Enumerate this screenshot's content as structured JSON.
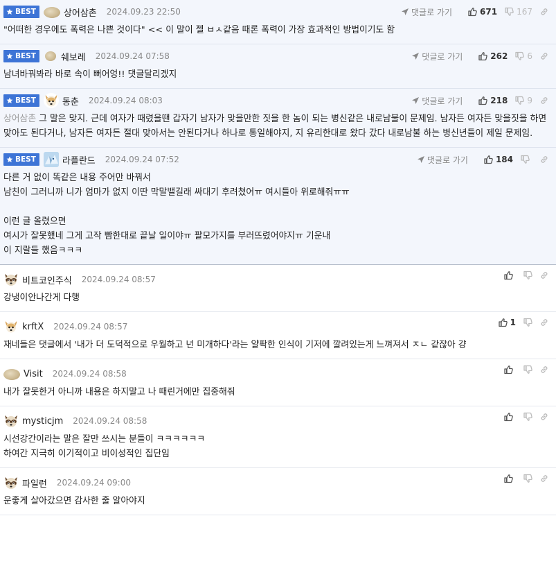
{
  "ui": {
    "best_label": "BEST",
    "reply_label": "댓글로 가기"
  },
  "best_comments": [
    {
      "avatar": "pebble",
      "name": "상어삼촌",
      "date": "2024.09.23 22:50",
      "up": "671",
      "down": "167",
      "lines": [
        "\"어떠한 경우에도 폭력은 나쁜 것이다\" << 이 말이 젤 ㅂㅅ같음 때론 폭력이 가장 효과적인 방법이기도 함"
      ]
    },
    {
      "avatar": "pebble-small",
      "name": "쉐보레",
      "date": "2024.09.24 07:58",
      "up": "262",
      "down": "6",
      "lines": [
        "남녀바꿔봐라 바로 속이 뻐어엉!! 댓글달리겠지"
      ]
    },
    {
      "avatar": "dog",
      "name": "동춘",
      "date": "2024.09.24 08:03",
      "up": "218",
      "down": "9",
      "mention": "상어삼촌",
      "lines": [
        " 그 말은 맞지. 근데 여자가 때렸을땐 갑자기 남자가 맞을만한 짓을 한 놈이 되는 병신같은 내로남불이 문제임. 남자든 여자든 맞을짓을 하면 맞아도 된다거나, 남자든 여자든 절대 맞아서는 안된다거나 하나로 통일해야지, 지 유리한대로 왔다 갔다 내로남불 하는 병신년들이 제일 문제임."
      ]
    },
    {
      "avatar": "ice",
      "name": "라플란드",
      "date": "2024.09.24 07:52",
      "up": "184",
      "down": "",
      "lines": [
        "다른 거 없이 똑같은 내용 주어만 바꿔서",
        "남친이 그러니까 니가 엄마가 없지 이딴 막말밸길래 싸대기 후려쳤어ㅠ 여시들아 위로해줘ㅠㅠ",
        "",
        "이런 글 올렸으면",
        "여시가 잘못했네 그게 고작 빰한대로 끝날 일이야ㅠ 팔모가지를 부러뜨렸어야지ㅠ 기운내",
        "이 지랄들 했음ㅋㅋㅋ"
      ]
    }
  ],
  "comments": [
    {
      "avatar": "raccoon",
      "name": "비트코인주식",
      "date": "2024.09.24 08:57",
      "up": "",
      "lines": [
        "강냉이안나간게 다행"
      ]
    },
    {
      "avatar": "dog",
      "name": "krftX",
      "date": "2024.09.24 08:57",
      "up": "1",
      "lines": [
        "재네들은 댓글에서 '내가 더 도덕적으로 우월하고 넌 미개하다'라는 얄팍한 인식이 기저에 깔려있는게 느껴져서 ㅈㄴ 같잖아 걍"
      ]
    },
    {
      "avatar": "pebble",
      "name": "Visit",
      "date": "2024.09.24 08:58",
      "up": "",
      "lines": [
        "내가 잘못한거 아니까 내용은 하지말고 나 때린거에만 집중해줘"
      ]
    },
    {
      "avatar": "raccoon",
      "name": "mysticjm",
      "date": "2024.09.24 08:58",
      "up": "",
      "lines": [
        "시선강간이라는 말은 잘만 쓰시는 분들이 ㅋㅋㅋㅋㅋㅋ",
        "하여간 지극히 이기적이고 비이성적인 집단임"
      ]
    },
    {
      "avatar": "raccoon",
      "name": "파일런",
      "date": "2024.09.24 09:00",
      "up": "",
      "lines": [
        "운좋게 살아갔으면 감사한 줄 알아야지"
      ]
    }
  ]
}
